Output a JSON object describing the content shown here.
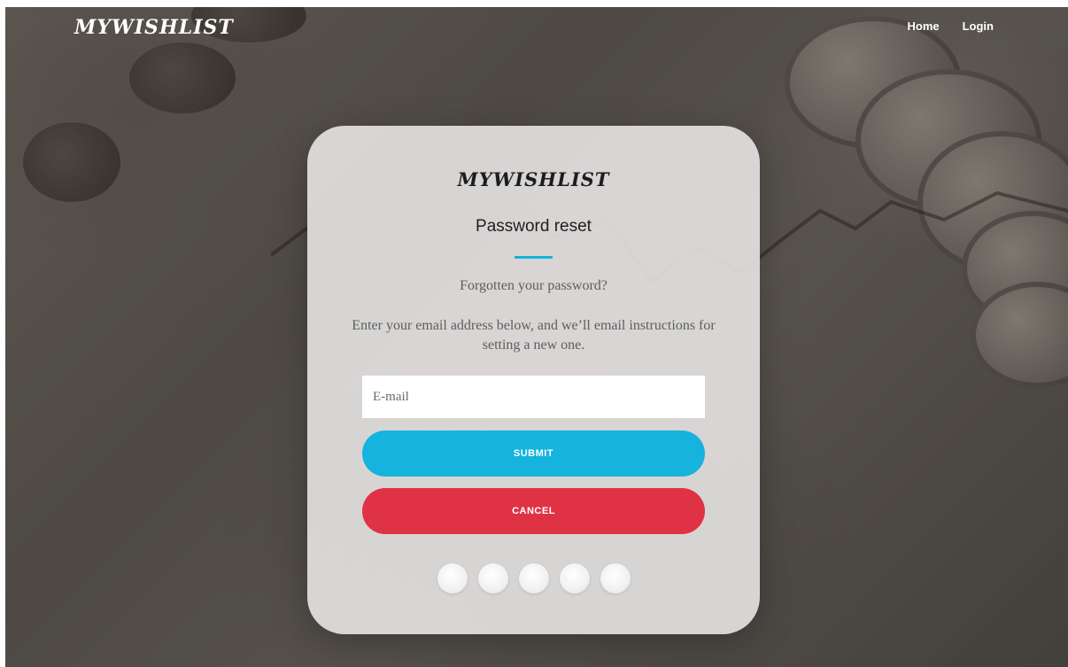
{
  "nav": {
    "logo": "MYWISHLIST",
    "links": [
      {
        "label": "Home"
      },
      {
        "label": "Login"
      }
    ]
  },
  "card": {
    "logo": "MYWISHLIST",
    "title": "Password reset",
    "subtitle": "Forgotten your password?",
    "description": "Enter your email address below, and we’ll email instructions for setting a new one.",
    "email_placeholder": "E-mail",
    "email_value": "",
    "submit_label": "SUBMIT",
    "cancel_label": "CANCEL"
  },
  "colors": {
    "accent": "#15b3de",
    "danger": "#df3345",
    "rule": "#17b2dd"
  }
}
